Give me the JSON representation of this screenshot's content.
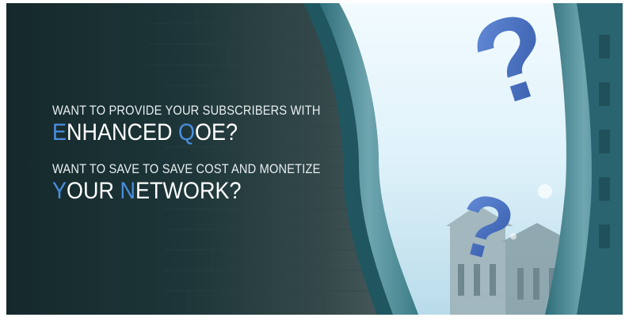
{
  "banner": {
    "line1": "WANT TO PROVIDE YOUR SUBSCRIBERS WITH",
    "line2_accent1": "E",
    "line2_part1": "NHANCED ",
    "line2_accent2": "Q",
    "line2_part2": "OE?",
    "line3": "WANT TO SAVE TO SAVE COST AND MONETIZE",
    "line4_accent1": "Y",
    "line4_part1": "OUR ",
    "line4_accent2": "N",
    "line4_part2": "ETWORK?"
  },
  "colors": {
    "background_dark": "#15292c",
    "accent_blue": "#4a8fe0",
    "question_mark_blue": "#3f6fc0",
    "sky": "#e6f5fb"
  },
  "decor": {
    "question_mark_count": 2,
    "icon_names": [
      "question-mark-icon",
      "question-mark-icon"
    ]
  }
}
